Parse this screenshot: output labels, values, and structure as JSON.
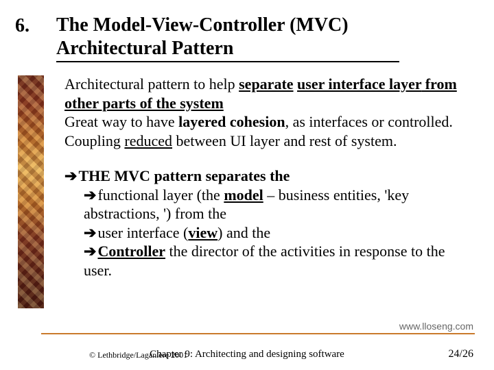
{
  "slide": {
    "number": "6.",
    "title": "The Model-View-Controller (MVC) Architectural Pattern"
  },
  "para": {
    "p1a": "Architectural pattern to help ",
    "p1b": "separate",
    "p1c": " ",
    "p1d": "user interface layer",
    "p1e": " from other parts of the system",
    "p2a": "Great way to have ",
    "p2b": "layered cohesion",
    "p2c": ", as interfaces or controlled.",
    "p3a": "Coupling ",
    "p3b": "reduced",
    "p3c": " between UI layer and rest of  system."
  },
  "mvc": {
    "l1": "THE MVC pattern separates the",
    "l2a": "functional layer (the ",
    "l2b": "model",
    "l2c": " – business entities, 'key abstractions, ') from the",
    "l3a": "user interface (",
    "l3b": "view",
    "l3c": ") and the",
    "l4a": "Controller",
    "l4b": " the director of the activities in response to the user."
  },
  "footer": {
    "url": "www.lloseng.com",
    "copyright": "© Lethbridge/Laganière 2001",
    "chapter": "Chapter 9: Architecting and designing software",
    "page": "24/26"
  }
}
